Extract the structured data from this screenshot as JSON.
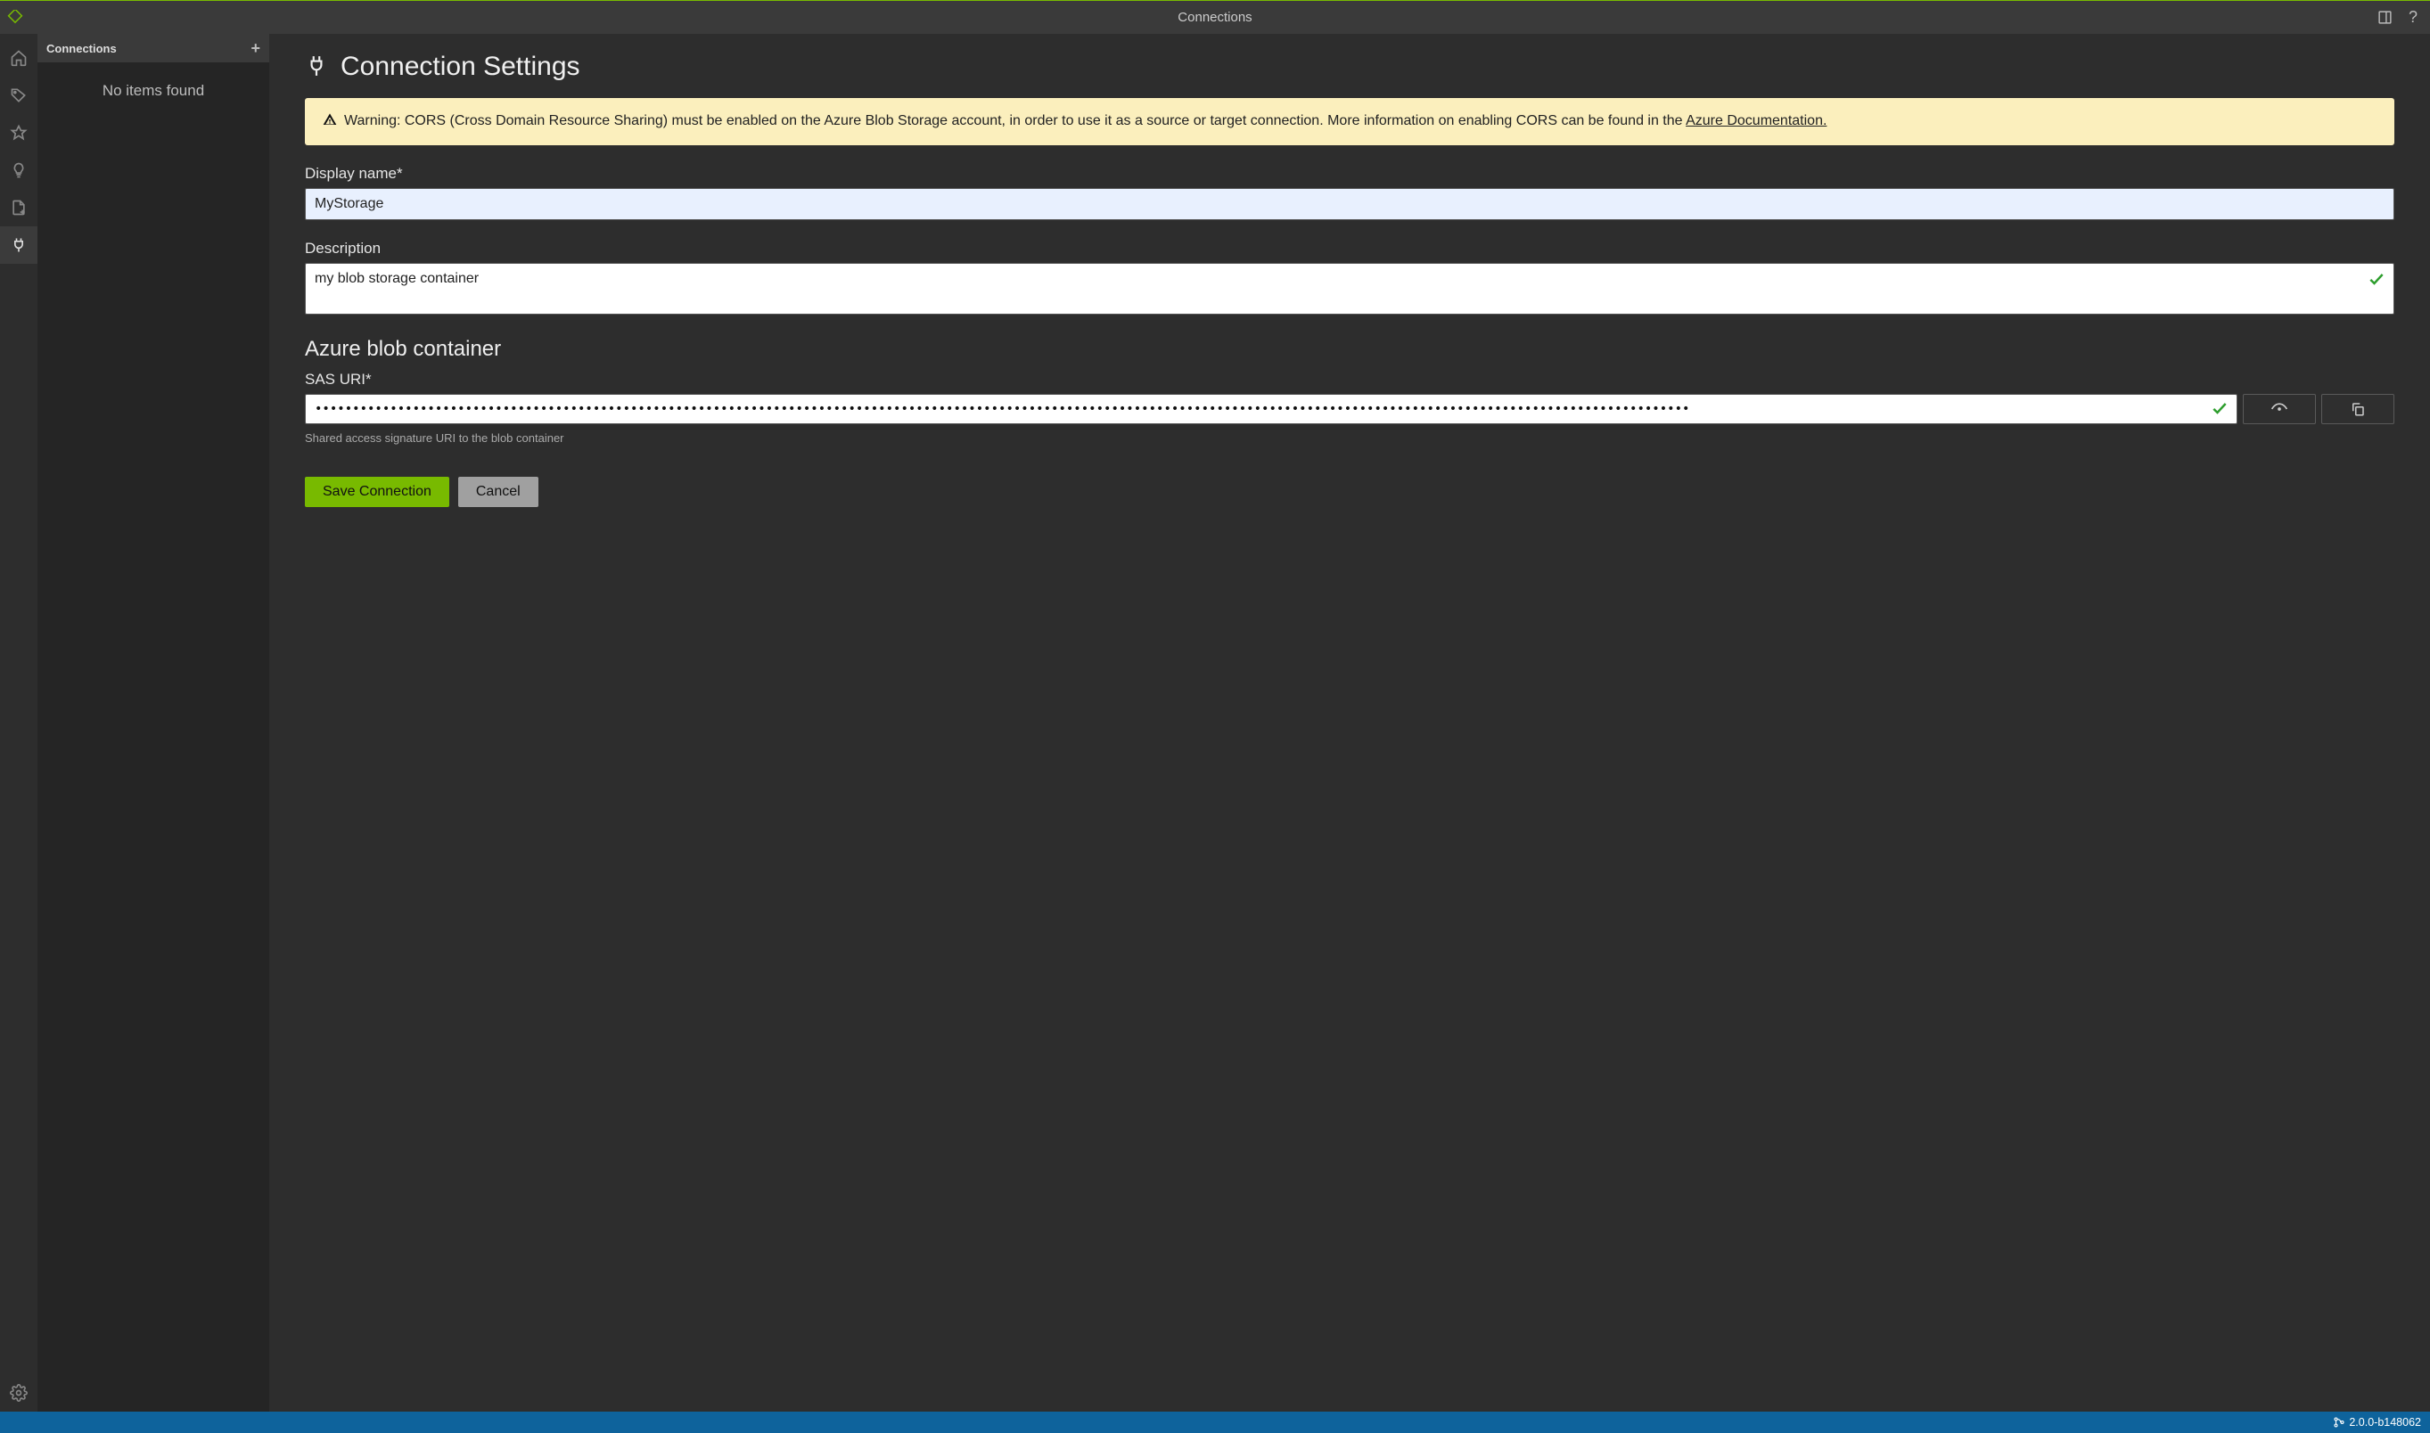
{
  "titlebar": {
    "title": "Connections"
  },
  "sidepanel": {
    "header": "Connections",
    "empty": "No items found"
  },
  "page": {
    "title": "Connection Settings",
    "warning": {
      "prefix": "Warning: CORS (Cross Domain Resource Sharing) must be enabled on the Azure Blob Storage account, in order to use it as a source or target connection. More information on enabling CORS can be found in the ",
      "link": "Azure Documentation."
    },
    "display_name_label": "Display name*",
    "display_name_value": "MyStorage",
    "description_label": "Description",
    "description_value": "my blob storage container",
    "provider_heading": "Azure blob container",
    "sas_label": "SAS URI*",
    "sas_masked": "•••••••••••••••••••••••••••••••••••••••••••••••••••••••••••••••••••••••••••••••••••••••••••••••••••••••••••••••••••••••••••••••••••••••••••••••••••••••••••••••••••••••••••••••••••••••",
    "sas_hint": "Shared access signature URI to the blob container",
    "save_label": "Save Connection",
    "cancel_label": "Cancel"
  },
  "statusbar": {
    "version": "2.0.0-b148062"
  }
}
